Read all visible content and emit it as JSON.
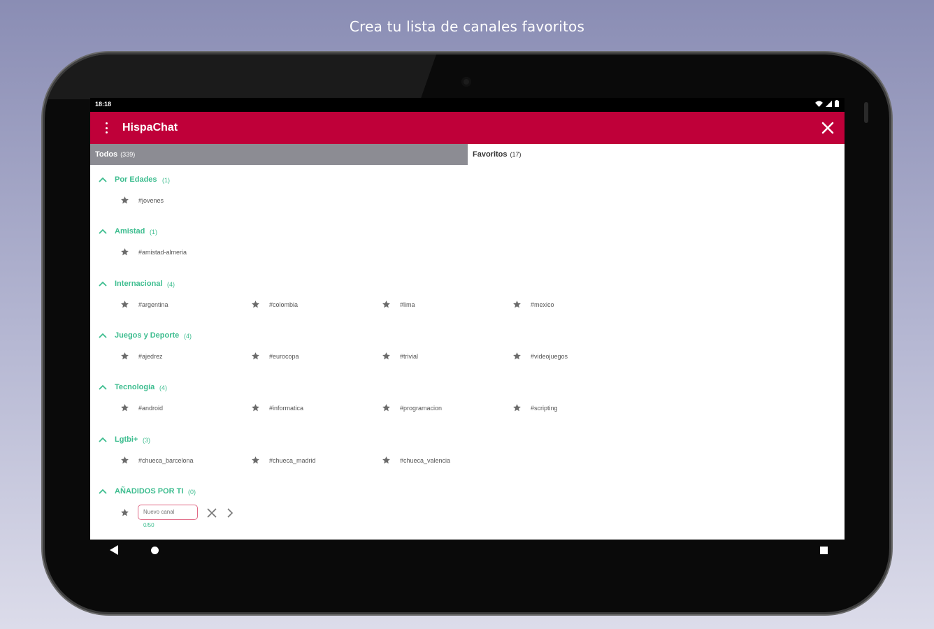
{
  "caption": "Crea tu lista de canales favoritos",
  "status_bar": {
    "time": "18:18"
  },
  "app_bar": {
    "title": "HispaChat",
    "menu_icon": "more-vert-icon",
    "close_icon": "close-icon"
  },
  "colors": {
    "app_bar": "#bf0039",
    "accent_green": "#3dbd8f",
    "tab_selected": "#8c8c93",
    "input_border": "#e06a86"
  },
  "tabs": [
    {
      "label": "Todos",
      "count": "(339)",
      "selected": true
    },
    {
      "label": "Favoritos",
      "count": "(17)",
      "selected": false
    }
  ],
  "categories": [
    {
      "name": "Por Edades",
      "count": "(1)",
      "channels": [
        "#jovenes"
      ]
    },
    {
      "name": "Amistad",
      "count": "(1)",
      "channels": [
        "#amistad-almeria"
      ]
    },
    {
      "name": "Internacional",
      "count": "(4)",
      "channels": [
        "#argentina",
        "#colombia",
        "#lima",
        "#mexico"
      ]
    },
    {
      "name": "Juegos y Deporte",
      "count": "(4)",
      "channels": [
        "#ajedrez",
        "#eurocopa",
        "#trivial",
        "#videojuegos"
      ]
    },
    {
      "name": "Tecnología",
      "count": "(4)",
      "channels": [
        "#android",
        "#informatica",
        "#programacion",
        "#scripting"
      ]
    },
    {
      "name": "Lgtbi+",
      "count": "(3)",
      "channels": [
        "#chueca_barcelona",
        "#chueca_madrid",
        "#chueca_valencia"
      ]
    },
    {
      "name": "AÑADIDOS POR TI",
      "count": "(0)",
      "channels": []
    }
  ],
  "new_channel": {
    "placeholder": "Nuevo canal",
    "counter": "0/50"
  },
  "icons": {
    "star": "star-icon",
    "chevron": "chevron-up-icon",
    "clear": "clear-icon",
    "go": "chevron-right-icon"
  }
}
